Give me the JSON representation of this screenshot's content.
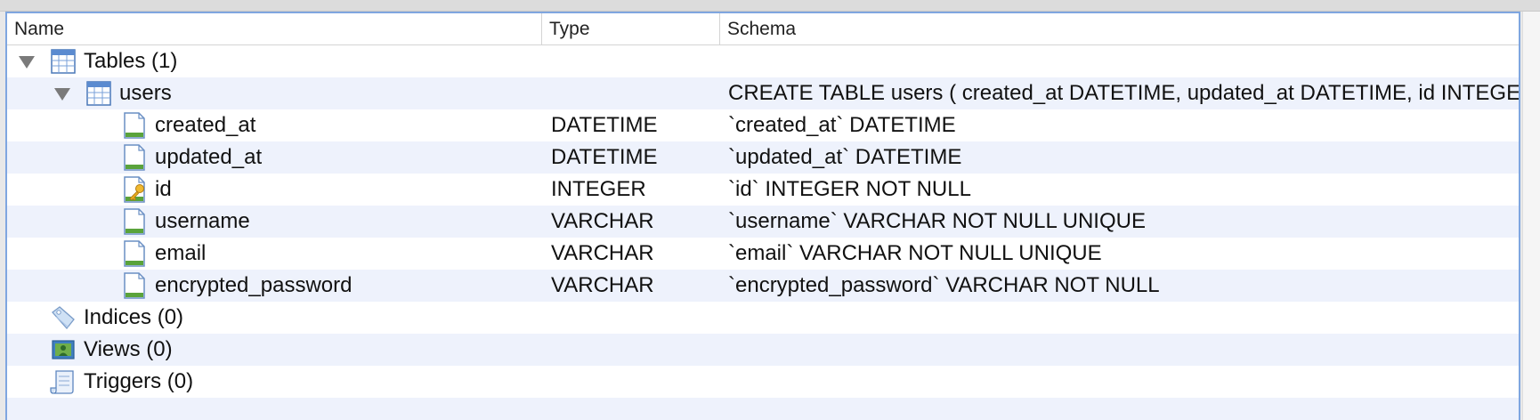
{
  "columns": {
    "name": "Name",
    "type": "Type",
    "schema": "Schema"
  },
  "tree": {
    "tables": {
      "label": "Tables (1)",
      "icon": "table-icon"
    },
    "users": {
      "label": "users",
      "icon": "table-icon",
      "schema": "CREATE TABLE users ( created_at DATETIME, updated_at DATETIME, id INTEGER NOT NULL, username VARCHAR NOT NULL UNIQUE, email VARCHAR NOT NULL UNIQUE, encrypted_password VARCHAR NOT NULL, PRIMARY KEY (id) )"
    },
    "fields": [
      {
        "name": "created_at",
        "type": "DATETIME",
        "schema": "`created_at` DATETIME",
        "icon": "field-icon"
      },
      {
        "name": "updated_at",
        "type": "DATETIME",
        "schema": "`updated_at` DATETIME",
        "icon": "field-icon"
      },
      {
        "name": "id",
        "type": "INTEGER",
        "schema": "`id` INTEGER NOT NULL",
        "icon": "primary-key-field-icon"
      },
      {
        "name": "username",
        "type": "VARCHAR",
        "schema": "`username` VARCHAR NOT NULL UNIQUE",
        "icon": "field-icon"
      },
      {
        "name": "email",
        "type": "VARCHAR",
        "schema": "`email` VARCHAR NOT NULL UNIQUE",
        "icon": "field-icon"
      },
      {
        "name": "encrypted_password",
        "type": "VARCHAR",
        "schema": "`encrypted_password` VARCHAR NOT NULL",
        "icon": "field-icon"
      }
    ],
    "indices": {
      "label": "Indices (0)",
      "icon": "index-tag-icon"
    },
    "views": {
      "label": "Views (0)",
      "icon": "view-icon"
    },
    "triggers": {
      "label": "Triggers (0)",
      "icon": "trigger-scroll-icon"
    }
  },
  "colors": {
    "alt_row": "#eef2fc",
    "focus_border": "#7fa6e0",
    "field_bar": "#5aa33b"
  }
}
